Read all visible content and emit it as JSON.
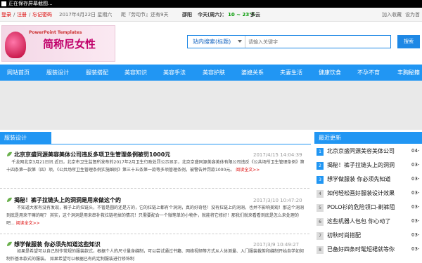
{
  "statusbar": {
    "text": "正在保存屏幕截图..."
  },
  "topbar": {
    "login": "登录",
    "sep1": "/",
    "register": "注册",
    "sep2": "/",
    "forgot": "忘记密码",
    "date": "2017年4月22日 星期六",
    "countdown": "距『劳动节』还有9天",
    "city": "邵阳",
    "today": "今天(周六)：",
    "temp": "10 ~ 23℃",
    "weather": "多云",
    "bookmark": "加入收藏",
    "homepage": "设为首"
  },
  "logo": {
    "ppt": "PowerPoint Templates",
    "name": "简称尼女性"
  },
  "search": {
    "select_label": "站内搜索(标题)",
    "placeholder": "请输入关键字",
    "button": "搜索"
  },
  "nav": [
    "网站首页",
    "服装设计",
    "服装搭配",
    "美容知识",
    "美容手法",
    "美容护肤",
    "婆媳关系",
    "夫妻生活",
    "健康饮食",
    "不孕不育",
    "丰胸秘籍"
  ],
  "left_section": {
    "title": "服装设计"
  },
  "articles": [
    {
      "title": "北京京盛同源美容美体公司违反多项卫生管理条例被罚1000元",
      "date": "2017/4/15 14:04:39",
      "body": "千龙网北京3月21日讯 近日，北京市卫生监督所发布的2017年2月卫生行政处罚公示显示，北京京盛同源美容美体有限公司违反《公共场所卫生管理条例》第十四条第一款第（四）项，《公共场所卫生管理条例实施细则》第三十五条第一款等多项管理条例，被警告并罚款1000元。",
      "more": "阅读全文>>"
    },
    {
      "title": "揭秘！裤子拉链头上的洞洞是用来做这个的",
      "date": "2017/3/10 10:47:20",
      "body": "不知道大家有没有发现，裤子上的拉链头，不管是圆的还是方的，它的拉链上都有个洞洞，真的好奇怪！没有拉链上的洞洞，也并不影响美观！那这个洞洞到底是用来干嘛的呢？    其实，这个洞洞是用来串补救拉链老掉的情况！只需要配合一个微笔单的小物件，就能将它修好！那我们就来看看到底是怎么来处理的吧...",
      "more": "阅读全文>>"
    },
    {
      "title": "想学做服装 你必须先知道这些知识",
      "date": "2017/3/9 10:49:27",
      "body": "如果是希望可以自己制作常规的服装款式，根据个人的尺寸量身缝制，可以尝试通过书籍、网络视频等方式从人体测量、入门服装裁剪和缝制开始自学如何制作基本款式的服装。    如果希望可以根据已有的定制服装进行修饰制",
      "more": ""
    }
  ],
  "right_section": {
    "title": "最近更新",
    "items": [
      {
        "num": "1",
        "text": "北京京盛同源美容美体公司",
        "date": "04-"
      },
      {
        "num": "2",
        "text": "揭秘！裤子拉链头上的洞洞",
        "date": "03-"
      },
      {
        "num": "3",
        "text": "想学做服装 你必须先知道",
        "date": "03-"
      },
      {
        "num": "4",
        "text": "如何轻松画好服装设计效果",
        "date": "03-"
      },
      {
        "num": "5",
        "text": "POLO衫的危险领口-剃裤阻",
        "date": "03-"
      },
      {
        "num": "6",
        "text": "这些机器人包包 你心动了",
        "date": "03-"
      },
      {
        "num": "7",
        "text": "初秋时尚搭配",
        "date": "03-"
      },
      {
        "num": "8",
        "text": "已备好四条时髦短裙就等你",
        "date": "03-"
      }
    ]
  }
}
